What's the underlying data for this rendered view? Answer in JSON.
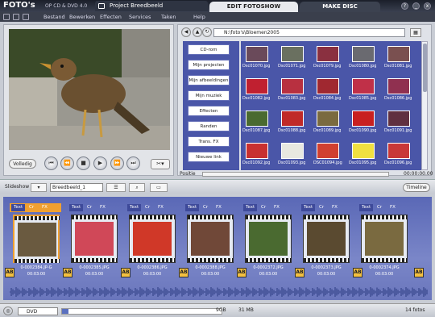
{
  "app": {
    "logo": "FOTO's",
    "version": "OP CD & DVD 4.0",
    "project": "Project Breedbeeld"
  },
  "tabs": [
    {
      "label": "EDIT FOTOSHOW"
    },
    {
      "label": "MAKE DISC"
    }
  ],
  "window": {
    "help": "?",
    "minimize": "_",
    "close": "x"
  },
  "menu": [
    "Bestand",
    "Bewerken",
    "Effecten",
    "Services",
    "Taken",
    "Help"
  ],
  "preview": {
    "fullscreen_label": "Volledig",
    "controls": [
      "⏮",
      "⏪",
      "■",
      "▶",
      "⏩",
      "⏭"
    ],
    "scissor": "✂▾"
  },
  "browser": {
    "path": "N:\\foto's\\Bloemen2005",
    "folders": [
      "CD-rom",
      "Mijn projecten",
      "Mijn afbeeldingen",
      "Mijn muziek",
      "Effecten",
      "Randen",
      "Trans. FX",
      "Nieuwe link"
    ],
    "thumbnails": [
      {
        "name": "Dsc01070.jpg",
        "color": "#6a4a5a"
      },
      {
        "name": "Dsc01071.jpg",
        "color": "#6a7060"
      },
      {
        "name": "Dsc01079.jpg",
        "color": "#8a3040"
      },
      {
        "name": "Dsc01080.jpg",
        "color": "#6a6a70"
      },
      {
        "name": "Dsc01081.jpg",
        "color": "#7a5050"
      },
      {
        "name": "Dsc01082.jpg",
        "color": "#c02030"
      },
      {
        "name": "Dsc01083.jpg",
        "color": "#b83040"
      },
      {
        "name": "Dsc01084.jpg",
        "color": "#a02830"
      },
      {
        "name": "Dsc01085.jpg",
        "color": "#c03048"
      },
      {
        "name": "Dsc01086.jpg",
        "color": "#903050"
      },
      {
        "name": "Dsc01087.jpg",
        "color": "#4a6a30"
      },
      {
        "name": "Dsc01088.jpg",
        "color": "#c02a28"
      },
      {
        "name": "Dsc01089.jpg",
        "color": "#7a6a40"
      },
      {
        "name": "Dsc01090.jpg",
        "color": "#c82020"
      },
      {
        "name": "Dsc01091.jpg",
        "color": "#603040"
      },
      {
        "name": "Dsc01092.jpg",
        "color": "#c83030"
      },
      {
        "name": "Dsc01093.jpg",
        "color": "#e8e8e0"
      },
      {
        "name": "DSC01094.jpg",
        "color": "#d04030"
      },
      {
        "name": "Dsc01095.jpg",
        "color": "#f0e040"
      },
      {
        "name": "Dsc01096.jpg",
        "color": "#c83838"
      }
    ],
    "position_label": "Positie",
    "position_time": "00:00:00.00"
  },
  "toolbar": {
    "slideshow_label": "Slideshow",
    "selected_show": "Breedbeeld_1",
    "timeline_label": "Timeline"
  },
  "clips": [
    {
      "text": "Text",
      "name": "0-0002384.JP-G",
      "duration": "00:03:00",
      "color": "#6a5a40",
      "selected": true
    },
    {
      "text": "Text",
      "name": "0-0002385.JPG",
      "duration": "00:03:00",
      "color": "#d04858",
      "selected": false
    },
    {
      "text": "Text",
      "name": "0-0002386.JPG",
      "duration": "00:03:00",
      "color": "#d03828",
      "selected": false
    },
    {
      "text": "Text",
      "name": "0-0002388.JPG",
      "duration": "00:03:00",
      "color": "#704838",
      "selected": false
    },
    {
      "text": "Text",
      "name": "0-0002372.JPG",
      "duration": "00:03:00",
      "color": "#4a6a30",
      "selected": false
    },
    {
      "text": "Text",
      "name": "0-0002373.JPG",
      "duration": "00:03:00",
      "color": "#5a4a30",
      "selected": false
    },
    {
      "text": "Text",
      "name": "0-0002374.JPG",
      "duration": "00:03:00",
      "color": "#7a6a40",
      "selected": false
    }
  ],
  "clip_controls": {
    "cr": "Cr",
    "fx": "FX",
    "ab": "AB"
  },
  "status": {
    "format": "DVD",
    "gb": "9GB",
    "mb": "31 MB",
    "count": "14 fotos"
  }
}
